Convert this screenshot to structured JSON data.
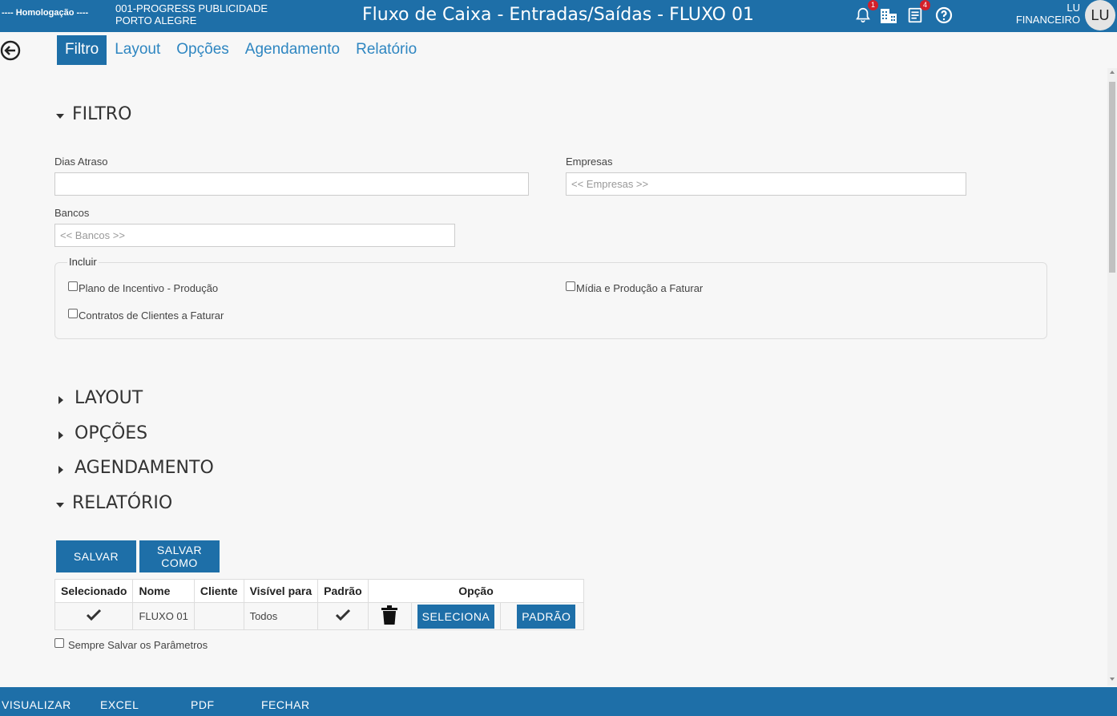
{
  "header": {
    "environment": "---- Homologação ----",
    "company_line1": "001-PROGRESS PUBLICIDADE",
    "company_line2": "PORTO ALEGRE",
    "title": "Fluxo de Caixa - Entradas/Saídas - FLUXO 01",
    "notifications_badge": "1",
    "documents_badge": "4",
    "user_name": "LU",
    "user_role": "FINANCEIRO",
    "avatar_initials": "LU",
    "icons": [
      "bell-icon",
      "buildings-icon",
      "document-icon",
      "help-icon"
    ]
  },
  "tabs": [
    {
      "label": "Filtro",
      "active": true
    },
    {
      "label": "Layout",
      "active": false
    },
    {
      "label": "Opções",
      "active": false
    },
    {
      "label": "Agendamento",
      "active": false
    },
    {
      "label": "Relatório",
      "active": false
    }
  ],
  "filtro": {
    "heading": "FILTRO",
    "dias_atraso_label": "Dias Atraso",
    "dias_atraso_value": "",
    "empresas_label": "Empresas",
    "empresas_placeholder": "<< Empresas >>",
    "bancos_label": "Bancos",
    "bancos_placeholder": "<< Bancos >>",
    "incluir_legend": "Incluir",
    "checkboxes": [
      {
        "label": "Plano de Incentivo - Produção",
        "checked": false
      },
      {
        "label": "Mídia e Produção a Faturar",
        "checked": false
      },
      {
        "label": "Contratos de Clientes a Faturar",
        "checked": false
      }
    ]
  },
  "sections": {
    "layout": "LAYOUT",
    "opcoes": "OPÇÕES",
    "agendamento": "AGENDAMENTO",
    "relatorio": "RELATÓRIO"
  },
  "relatorio": {
    "salvar_label": "SALVAR",
    "salvar_como_line1": "SALVAR",
    "salvar_como_line2": "COMO",
    "columns": [
      "Selecionado",
      "Nome",
      "Cliente",
      "Visível para",
      "Padrão",
      "Opção"
    ],
    "row": {
      "nome": "FLUXO 01",
      "cliente": "",
      "visivel_para": "Todos",
      "seleciona_label": "SELECIONA",
      "padrao_label": "PADRÃO"
    },
    "sempre_salvar_label": "Sempre Salvar os Parâmetros"
  },
  "footer": {
    "visualizar": "VISUALIZAR",
    "excel": "EXCEL",
    "pdf": "PDF",
    "fechar": "FECHAR"
  },
  "colors": {
    "primary": "#1e6fa8",
    "tab_text": "#2e86c1",
    "badge": "#d3202a",
    "background": "#f7f7f7"
  }
}
